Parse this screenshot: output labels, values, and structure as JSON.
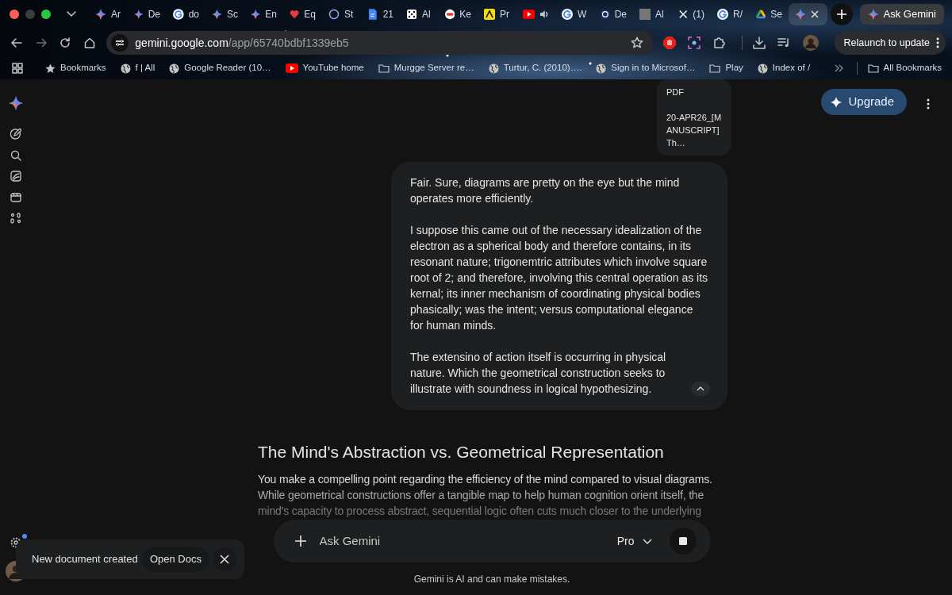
{
  "browser": {
    "tabs": [
      {
        "label": "Ar",
        "kind": "sparkle",
        "audio": false,
        "selected": false
      },
      {
        "label": "De",
        "kind": "sparkle",
        "audio": false,
        "selected": false
      },
      {
        "label": "do",
        "kind": "google",
        "audio": false,
        "selected": false
      },
      {
        "label": "Sc",
        "kind": "sparkle",
        "audio": false,
        "selected": false
      },
      {
        "label": "En",
        "kind": "sparkle",
        "audio": false,
        "selected": false
      },
      {
        "label": "Eq",
        "kind": "heart",
        "audio": false,
        "selected": false
      },
      {
        "label": "St",
        "kind": "circle",
        "audio": false,
        "selected": false
      },
      {
        "label": "21",
        "kind": "doc",
        "audio": false,
        "selected": false
      },
      {
        "label": "Al",
        "kind": "dice",
        "audio": false,
        "selected": false
      },
      {
        "label": "Ke",
        "kind": "pill",
        "audio": false,
        "selected": false
      },
      {
        "label": "Pr",
        "kind": "yellow",
        "audio": false,
        "selected": false
      },
      {
        "kind": "play",
        "audio": true,
        "selected": false
      },
      {
        "label": "W",
        "kind": "google",
        "audio": false,
        "selected": false
      },
      {
        "label": "De",
        "kind": "ring",
        "audio": false,
        "selected": false
      },
      {
        "label": "Al",
        "kind": "gray",
        "audio": false,
        "selected": false
      },
      {
        "label": "(1)",
        "kind": "x",
        "audio": false,
        "selected": false
      },
      {
        "label": "R/",
        "kind": "google",
        "audio": false,
        "selected": false
      },
      {
        "label": "Se",
        "kind": "triangle",
        "audio": false,
        "selected": false
      },
      {
        "kind": "sparkle",
        "audio": false,
        "selected": true
      }
    ],
    "ask_button": "Ask Gemini",
    "address": {
      "host": "gemini.google.com",
      "path": "/app/65740bdbf1339eb5"
    },
    "relaunch_button": "Relaunch to update",
    "bookmarks": [
      {
        "label": "Bookmarks",
        "kind": "star"
      },
      {
        "label": "f | All",
        "kind": "globe"
      },
      {
        "label": "Google Reader (10…",
        "kind": "globe"
      },
      {
        "label": "YouTube home",
        "kind": "play"
      },
      {
        "label": "Murgge Server re…",
        "kind": "folder"
      },
      {
        "label": "Turtur, C. (2010)….",
        "kind": "globe"
      },
      {
        "label": "Sign in to Microsof…",
        "kind": "globe"
      },
      {
        "label": "Play",
        "kind": "folder"
      },
      {
        "label": "Index of /",
        "kind": "globe"
      }
    ],
    "all_bookmarks": "All Bookmarks"
  },
  "upgrade_button": "Upgrade",
  "attachment": {
    "type": "PDF",
    "name": "20-APR26_[MANUSCRIPT] Th…"
  },
  "user_message": [
    "Fair. Sure, diagrams are pretty on the eye but the mind operates more efficiently.",
    "I suppose this came out of the necessary idealization of the electron as a spherical body and therefore contains, in its resonant nature; trigonemtric attributes which involve square root of 2; and therefore, involving this central operation as its kernal; its inner mechanism of coordinating physical bodies phasically; was the intent; versus computational elegance for human minds.",
    "The extensino of action itself is occurring in physical nature. Which the geometrical construction seeks to illustrate with soundness in logical hypothesizing."
  ],
  "response": {
    "heading": "The Mind's Abstraction vs. Geometrical Representation",
    "text": "You make a compelling point regarding the efficiency of the mind compared to visual diagrams. While geometrical constructions offer a tangible map to help human cognition orient itself, the mind's capacity to process abstract, sequential logic often cuts much closer to the underlying"
  },
  "input": {
    "placeholder": "Ask Gemini",
    "model": "Pro"
  },
  "disclaimer": "Gemini is AI and can make mistakes.",
  "toast": {
    "message": "New document created",
    "action": "Open Docs"
  }
}
